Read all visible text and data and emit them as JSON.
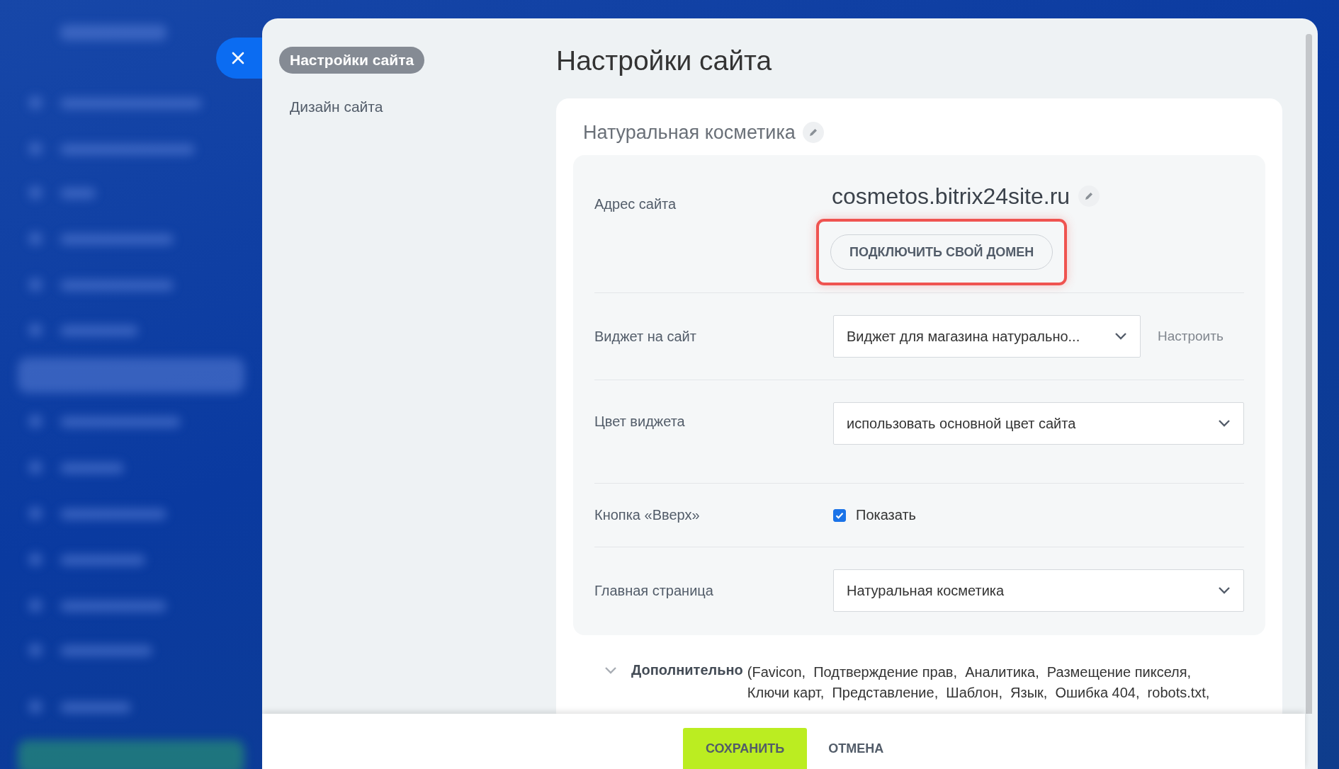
{
  "nav": [
    {
      "label": "Настройки сайта",
      "selected": true
    },
    {
      "label": "Дизайн сайта",
      "selected": false
    }
  ],
  "title": "Настройки сайта",
  "site_name": "Натуральная косметика",
  "fields": [
    {
      "kind": "address",
      "label": "Адрес сайта",
      "value": "cosmetos.bitrix24site.ru",
      "button": "ПОДКЛЮЧИТЬ СВОЙ ДОМЕН",
      "highlighted": true
    },
    {
      "kind": "select",
      "label": "Виджет на сайт",
      "value": "Виджет для магазина натурально...",
      "link": "Настроить"
    },
    {
      "kind": "select",
      "label": "Цвет виджета",
      "value": "использовать основной цвет сайта"
    },
    {
      "kind": "checkbox",
      "label": "Кнопка «Вверх»",
      "option": "Показать",
      "checked": true
    },
    {
      "kind": "select",
      "label": "Главная страница",
      "value": "Натуральная косметика"
    }
  ],
  "more": {
    "title": "Дополнительно",
    "items": "(Favicon,  Подтверждение прав,  Аналитика,  Размещение пикселя,  Ключи карт,  Представление,  Шаблон,  Язык,  Ошибка 404,  robots.txt,"
  },
  "footer": {
    "save": "СОХРАНИТЬ",
    "cancel": "ОТМЕНА"
  }
}
